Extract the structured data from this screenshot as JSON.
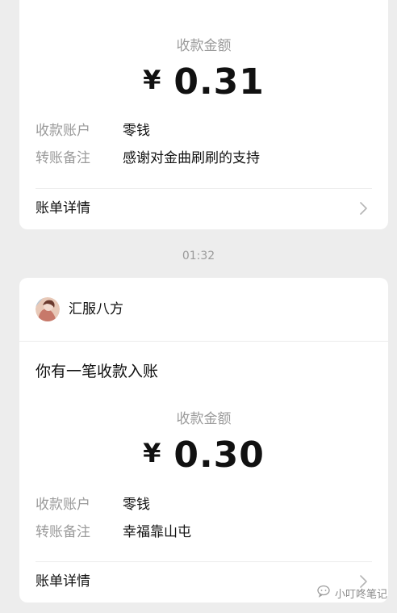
{
  "card1": {
    "amount_label": "收款金额",
    "currency": "¥",
    "amount": "0.31",
    "account_key": "收款账户",
    "account_value": "零钱",
    "note_key": "转账备注",
    "note_value": "感谢对金曲刷刷的支持",
    "bill_label": "账单详情"
  },
  "timestamp": "01:32",
  "card2": {
    "sender": "汇服八方",
    "message_title": "你有一笔收款入账",
    "amount_label": "收款金额",
    "currency": "¥",
    "amount": "0.30",
    "account_key": "收款账户",
    "account_value": "零钱",
    "note_key": "转账备注",
    "note_value": "幸福靠山屯",
    "bill_label": "账单详情"
  },
  "watermark": {
    "text": "小叮咚笔记",
    "icon": "wechat-official-account-icon"
  },
  "colors": {
    "background": "#ededed",
    "card": "#ffffff",
    "secondary_text": "#9a9a9a",
    "primary_text": "#111111"
  }
}
